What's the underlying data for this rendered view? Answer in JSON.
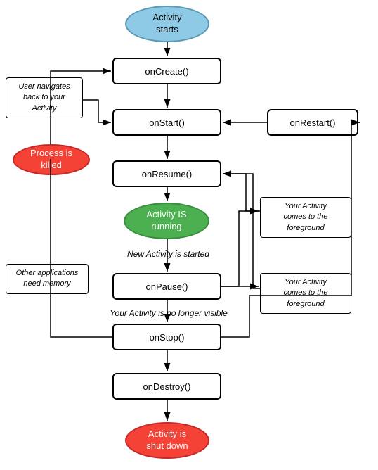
{
  "nodes": {
    "activity_starts": {
      "label": "Activity\nstarts"
    },
    "on_create": {
      "label": "onCreate()"
    },
    "on_start": {
      "label": "onStart()"
    },
    "on_restart": {
      "label": "onRestart()"
    },
    "on_resume": {
      "label": "onResume()"
    },
    "activity_running": {
      "label": "Activity IS\nrunning"
    },
    "on_pause": {
      "label": "onPause()"
    },
    "on_stop": {
      "label": "onStop()"
    },
    "on_destroy": {
      "label": "onDestroy()"
    },
    "activity_shutdown": {
      "label": "Activity is\nshut down"
    }
  },
  "labels": {
    "user_navigates": {
      "text": "User navigates\nback to your\nActivity"
    },
    "process_killed": {
      "text": "Process is\nkilled"
    },
    "new_activity_started": {
      "text": "New Activity is started"
    },
    "other_apps_memory": {
      "text": "Other applications\nneed memory"
    },
    "no_longer_visible": {
      "text": "Your Activity is no longer visible"
    },
    "comes_foreground_1": {
      "text": "Your Activity\ncomes to the\nforeground"
    },
    "comes_foreground_2": {
      "text": "Your Activity\ncomes to the\nforeground"
    }
  },
  "colors": {
    "blue_oval": "#8ecae6",
    "green_oval": "#4caf50",
    "red_oval_process": "#f44336",
    "red_oval_shutdown": "#f44336",
    "arrow": "#000"
  }
}
